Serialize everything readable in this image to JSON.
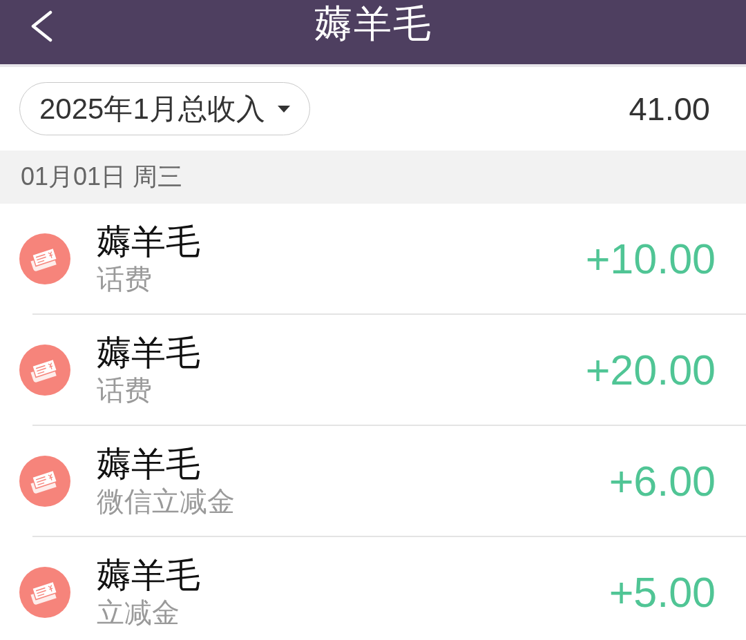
{
  "header": {
    "title": "薅羊毛"
  },
  "summary": {
    "period": "2025年1月总收入",
    "total": "41.00"
  },
  "days": [
    {
      "date": "01月01日 周三",
      "entries": [
        {
          "name": "薅羊毛",
          "category": "话费",
          "amount": "+10.00"
        },
        {
          "name": "薅羊毛",
          "category": "话费",
          "amount": "+20.00"
        },
        {
          "name": "薅羊毛",
          "category": "微信立减金",
          "amount": "+6.00"
        },
        {
          "name": "薅羊毛",
          "category": "立减金",
          "amount": "+5.00"
        }
      ]
    }
  ]
}
